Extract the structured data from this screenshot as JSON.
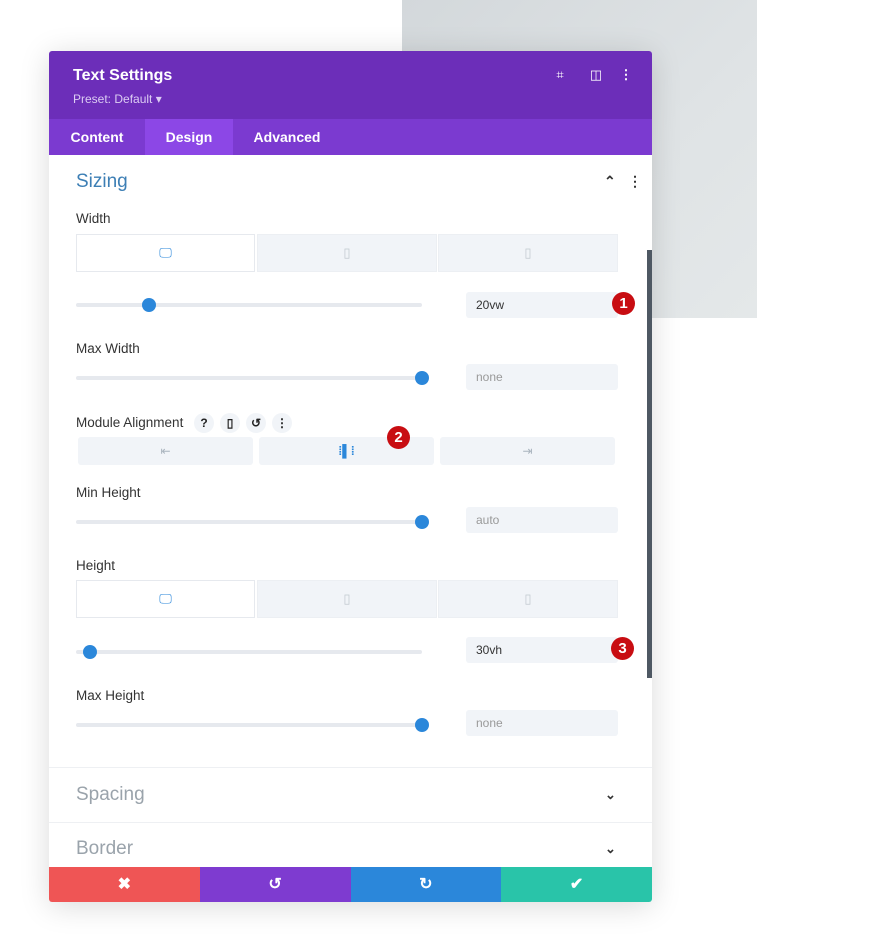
{
  "header": {
    "title": "Text Settings",
    "preset": "Preset: Default ▾",
    "icons": [
      "expand-icon",
      "split-view-icon",
      "more-icon"
    ]
  },
  "tabs": [
    {
      "label": "Content"
    },
    {
      "label": "Design",
      "active": true
    },
    {
      "label": "Advanced"
    }
  ],
  "sizing": {
    "title": "Sizing",
    "width": {
      "label": "Width",
      "value": "20vw",
      "slider_percent": 21
    },
    "max_width": {
      "label": "Max Width",
      "value": "none",
      "slider_percent": 100
    },
    "module_alignment": {
      "label": "Module Alignment",
      "help": "?",
      "selected": "center"
    },
    "min_height": {
      "label": "Min Height",
      "value": "auto",
      "slider_percent": 100
    },
    "height": {
      "label": "Height",
      "value": "30vh",
      "slider_percent": 4
    },
    "max_height": {
      "label": "Max Height",
      "value": "none",
      "slider_percent": 100
    }
  },
  "badges": [
    "1",
    "2",
    "3"
  ],
  "collapsed_sections": [
    {
      "title": "Spacing"
    },
    {
      "title": "Border"
    }
  ],
  "footer": {
    "cancel": "✖",
    "undo": "↺",
    "redo": "↻",
    "save": "✔"
  },
  "colors": {
    "header": "#6c2eb9",
    "tabs": "#7b3ad0",
    "accent": "#2b87da",
    "cancel": "#ef5555",
    "undo": "#7e3bd0",
    "redo": "#2b87da",
    "save": "#29c4a9",
    "badge": "#c80d12"
  }
}
